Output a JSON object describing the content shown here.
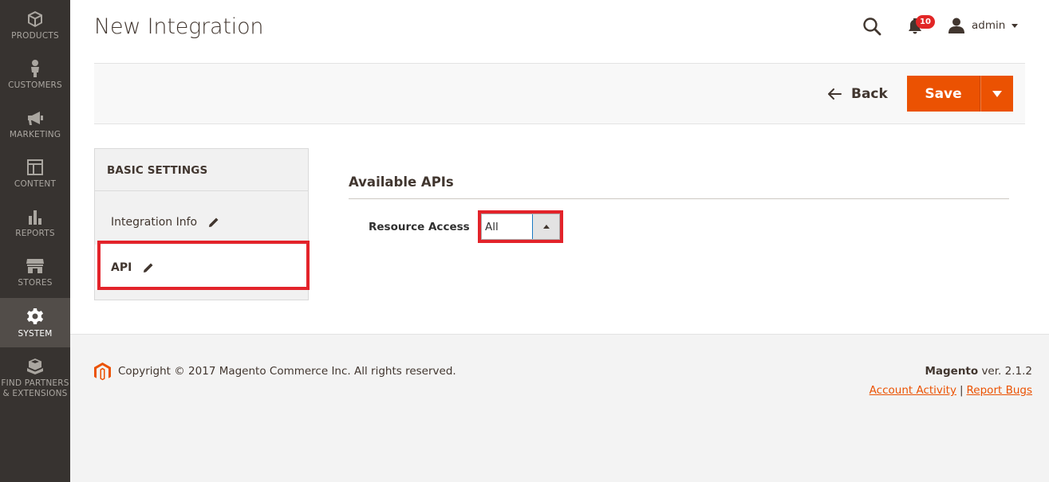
{
  "sidebar": {
    "items": [
      {
        "label": "PRODUCTS",
        "icon": "cube-icon"
      },
      {
        "label": "CUSTOMERS",
        "icon": "person-icon"
      },
      {
        "label": "MARKETING",
        "icon": "megaphone-icon"
      },
      {
        "label": "CONTENT",
        "icon": "layout-icon"
      },
      {
        "label": "REPORTS",
        "icon": "bar-chart-icon"
      },
      {
        "label": "STORES",
        "icon": "storefront-icon"
      },
      {
        "label": "SYSTEM",
        "icon": "gear-icon",
        "active": true
      },
      {
        "label": "FIND PARTNERS & EXTENSIONS",
        "icon": "boxes-icon"
      }
    ]
  },
  "header": {
    "title": "New Integration",
    "notifications_count": "10",
    "username": "admin"
  },
  "actions": {
    "back_label": "Back",
    "save_label": "Save"
  },
  "tabs": {
    "heading": "BASIC SETTINGS",
    "items": [
      {
        "label": "Integration Info"
      },
      {
        "label": "API",
        "active": true
      }
    ]
  },
  "main": {
    "section_title": "Available APIs",
    "resource_access_label": "Resource Access",
    "resource_access_value": "All"
  },
  "footer": {
    "copyright": "Copyright © 2017 Magento Commerce Inc. All rights reserved.",
    "brand": "Magento",
    "version": " ver. 2.1.2",
    "link_account_activity": "Account Activity",
    "link_separator": "|",
    "link_report_bugs": "Report Bugs"
  },
  "colors": {
    "accent": "#eb5202",
    "sidebar_bg": "#373330",
    "highlight": "#e3232a"
  }
}
